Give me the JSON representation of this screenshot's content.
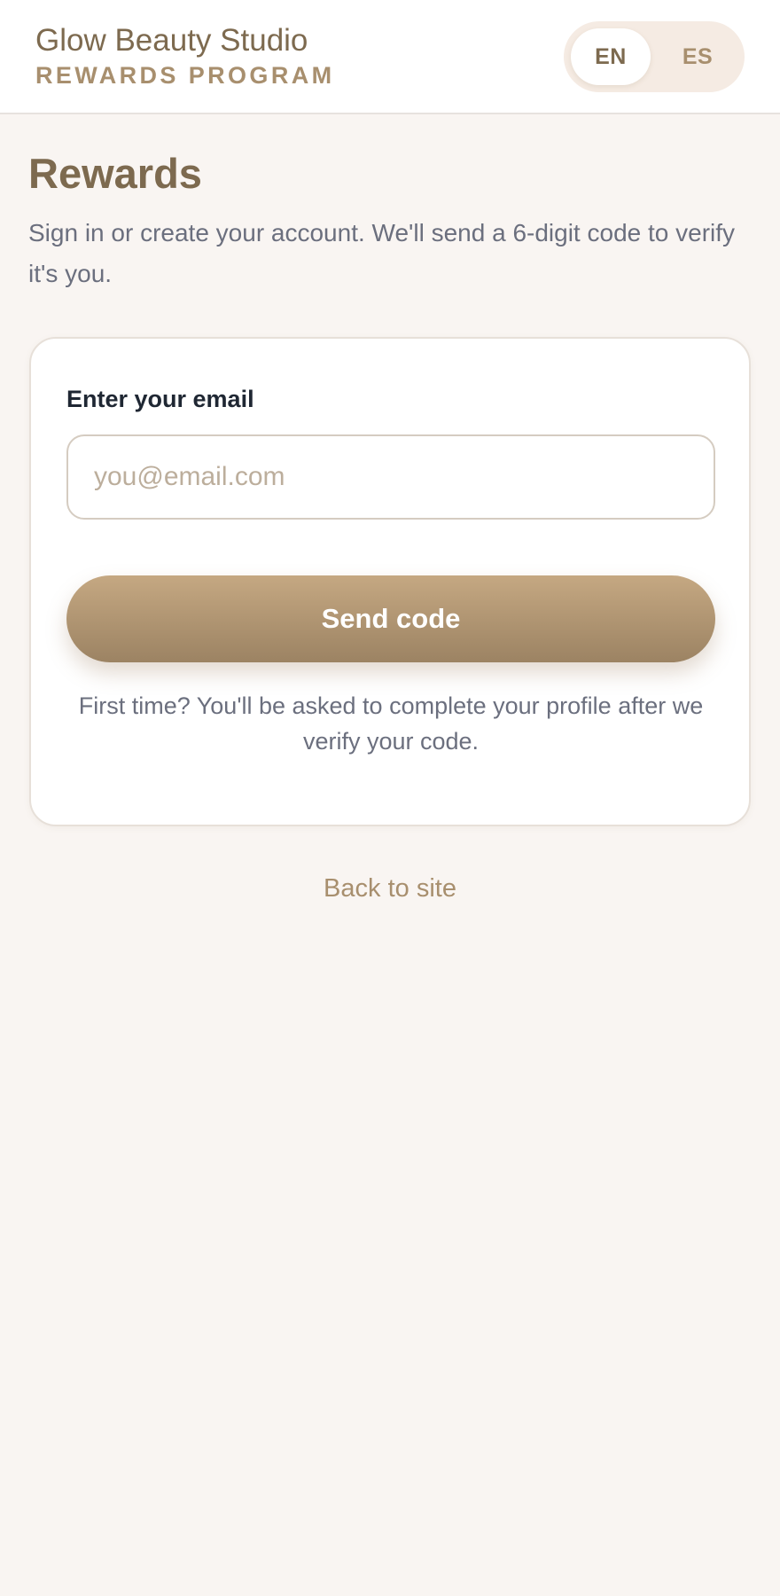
{
  "header": {
    "brand_name": "Glow Beauty Studio",
    "brand_subtitle": "REWARDS PROGRAM",
    "languages": [
      {
        "label": "EN",
        "active": true
      },
      {
        "label": "ES",
        "active": false
      }
    ]
  },
  "main": {
    "title": "Rewards",
    "description": "Sign in or create your account. We'll send a 6-digit code to verify it's you."
  },
  "form": {
    "email_label": "Enter your email",
    "email_value": "",
    "email_placeholder": "you@email.com",
    "submit_label": "Send code",
    "helper_text": "First time? You'll be asked to complete your profile after we verify your code."
  },
  "footer": {
    "back_link_label": "Back to site"
  },
  "colors": {
    "brand": "#7d6a4f",
    "accent": "#a88f6e",
    "button_top": "#c5a882",
    "button_bottom": "#9c8363",
    "background": "#f9f5f2",
    "text_muted": "#6b6f7e"
  }
}
